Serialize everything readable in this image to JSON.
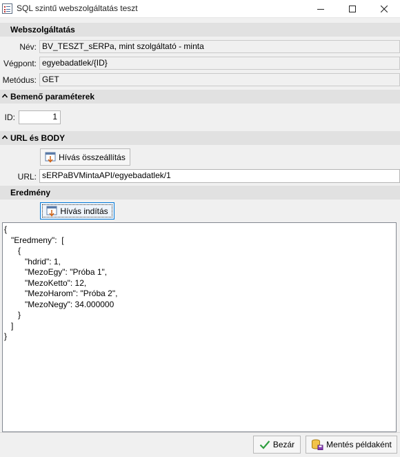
{
  "window": {
    "title": "SQL szintű webszolgáltatás teszt"
  },
  "webservice": {
    "header": "Webszolgáltatás",
    "name_label": "Név:",
    "name_value": "BV_TESZT_sERPa, mint szolgáltató - minta",
    "endpoint_label": "Végpont:",
    "endpoint_value": "egyebadatlek/{ID}",
    "method_label": "Metódus:",
    "method_value": "GET"
  },
  "input_params": {
    "header": "Bemenő paraméterek",
    "id_label": "ID:",
    "id_value": "1"
  },
  "url_body": {
    "header": "URL és BODY",
    "build_button": "Hívás összeállítás",
    "url_label": "URL:",
    "url_value": "sERPaBVMintaAPI/egyebadatlek/1"
  },
  "result": {
    "header": "Eredmény",
    "start_button": "Hívás indítás",
    "text": "{\n   \"Eredmeny\":  [\n      {\n         \"hdrid\": 1,\n         \"MezoEgy\": \"Próba 1\",\n         \"MezoKetto\": 12,\n         \"MezoHarom\": \"Próba 2\",\n         \"MezoNegy\": 34.000000\n      }\n   ]\n}"
  },
  "footer": {
    "close_button": "Bezár",
    "save_button": "Mentés példaként"
  },
  "colors": {
    "section_bg": "#e1e1e1",
    "window_bg": "#f0f0f0",
    "accent": "#0078d7"
  }
}
